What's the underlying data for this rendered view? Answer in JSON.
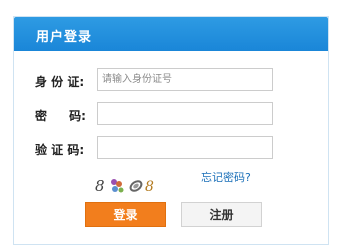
{
  "panel": {
    "title": "用户登录"
  },
  "form": {
    "id_label": "身 份 证:",
    "id_placeholder": "请输入身份证号",
    "password_label": "密 码:",
    "captcha_label": "验 证 码:",
    "captcha_text": "8器∅8",
    "forgot_link": "忘记密码?",
    "login_button": "登录",
    "register_button": "注册"
  },
  "colors": {
    "header": "#1a86d8",
    "login_button": "#f27e1d",
    "link": "#1a6fb8"
  }
}
